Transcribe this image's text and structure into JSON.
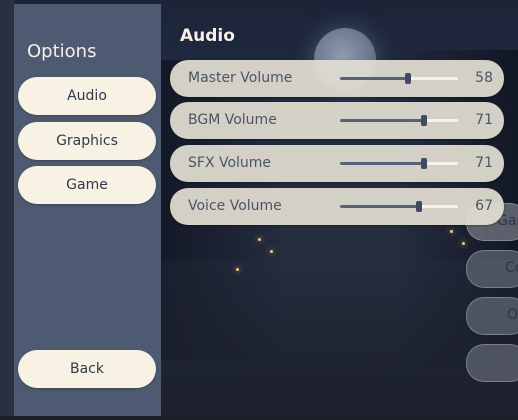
{
  "sidebar": {
    "title": "Options",
    "items": [
      {
        "label": "Audio"
      },
      {
        "label": "Graphics"
      },
      {
        "label": "Game"
      }
    ],
    "back_label": "Back"
  },
  "content": {
    "title": "Audio",
    "sliders": [
      {
        "label": "Master Volume",
        "value": "58",
        "level": 0.58
      },
      {
        "label": "BGM Volume",
        "value": "71",
        "level": 0.71
      },
      {
        "label": "SFX Volume",
        "value": "71",
        "level": 0.71
      },
      {
        "label": "Voice Volume",
        "value": "67",
        "level": 0.67
      }
    ]
  },
  "background_menu": {
    "items": [
      {
        "label": "Gar"
      },
      {
        "label": "Co"
      },
      {
        "label": "O"
      },
      {
        "label": ""
      }
    ]
  }
}
